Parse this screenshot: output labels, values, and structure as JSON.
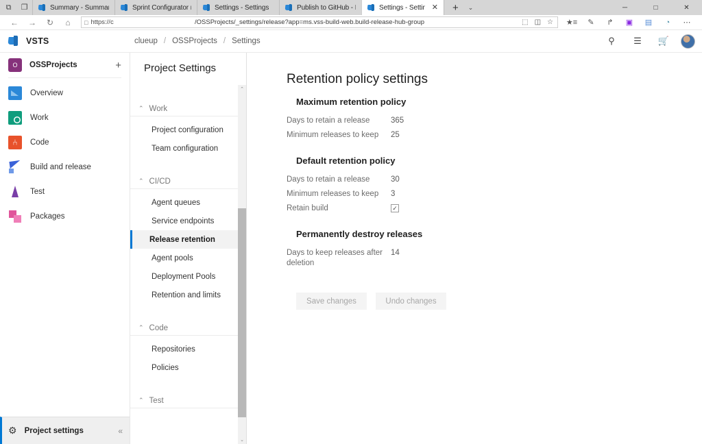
{
  "browser": {
    "window_controls": {
      "minimize": "─",
      "maximize": "□",
      "close": "✕"
    },
    "tab_controls": {
      "new_tab": "+",
      "tab_list": "⌄",
      "close_tab": "✕"
    },
    "left_buttons": [
      {
        "name": "tab-preview-icon",
        "glyph": "⧉"
      },
      {
        "name": "set-tabs-aside-icon",
        "glyph": "❐"
      }
    ],
    "tabs": [
      {
        "title": "Summary - Summary",
        "active": false
      },
      {
        "title": "Sprint Configurator master",
        "active": false
      },
      {
        "title": "Settings - Settings",
        "active": false
      },
      {
        "title": "Publish to GitHub - Build ar",
        "active": false
      },
      {
        "title": "Settings - Settings",
        "active": true
      }
    ],
    "nav_buttons": [
      {
        "name": "back-button",
        "glyph": "←"
      },
      {
        "name": "forward-button",
        "glyph": "→"
      },
      {
        "name": "refresh-button",
        "glyph": "↻"
      },
      {
        "name": "home-button",
        "glyph": "⌂"
      }
    ],
    "address": {
      "lock_glyph": "□",
      "prefix": "https://c",
      "path": "/OSSProjects/_settings/release?app=ms.vss-build-web.build-release-hub-group",
      "inline_icons": [
        {
          "name": "reading-view-icon",
          "glyph": "⬚"
        },
        {
          "name": "book-icon",
          "glyph": "◫"
        },
        {
          "name": "favorite-star-icon",
          "glyph": "☆"
        }
      ]
    },
    "toolbar_icons": [
      {
        "name": "favorites-hub-icon",
        "glyph": "★≡"
      },
      {
        "name": "web-notes-icon",
        "glyph": "✎"
      },
      {
        "name": "share-icon",
        "glyph": "↱"
      },
      {
        "name": "extension-icon",
        "glyph": "▣"
      },
      {
        "name": "devtools-icon",
        "glyph": "▤"
      },
      {
        "name": "cortana-icon",
        "glyph": "◔"
      },
      {
        "name": "more-menu-icon",
        "glyph": "⋯"
      }
    ]
  },
  "app_header": {
    "brand": "VSTS",
    "breadcrumb": [
      "clueup",
      "OSSProjects",
      "Settings"
    ],
    "breadcrumb_separator": "/",
    "actions": [
      {
        "name": "search-icon",
        "glyph": "⚲"
      },
      {
        "name": "work-items-icon",
        "glyph": "☰"
      },
      {
        "name": "marketplace-icon",
        "glyph": "Ὥ2"
      },
      {
        "name": "help-icon",
        "glyph": "?"
      }
    ]
  },
  "project_nav": {
    "project_initial": "O",
    "project_name": "OSSProjects",
    "add_glyph": "+",
    "items": [
      {
        "label": "Overview",
        "icon": "overview-icon"
      },
      {
        "label": "Work",
        "icon": "work-icon"
      },
      {
        "label": "Code",
        "icon": "code-icon"
      },
      {
        "label": "Build and release",
        "icon": "build-and-release-icon"
      },
      {
        "label": "Test",
        "icon": "test-icon"
      },
      {
        "label": "Packages",
        "icon": "packages-icon"
      }
    ],
    "footer": {
      "gear_glyph": "⚙",
      "label": "Project settings",
      "collapse_glyph": "«"
    }
  },
  "settings_nav": {
    "title": "Project Settings",
    "collapse_glyph": "⌃",
    "scroll_up_glyph": "⌃",
    "scroll_down_glyph": "⌄",
    "groups": [
      {
        "label": "Work",
        "items": [
          {
            "label": "Project configuration",
            "active": false
          },
          {
            "label": "Team configuration",
            "active": false
          }
        ]
      },
      {
        "label": "CI/CD",
        "items": [
          {
            "label": "Agent queues",
            "active": false
          },
          {
            "label": "Service endpoints",
            "active": false
          },
          {
            "label": "Release retention",
            "active": true
          },
          {
            "label": "Agent pools",
            "active": false
          },
          {
            "label": "Deployment Pools",
            "active": false
          },
          {
            "label": "Retention and limits",
            "active": false
          }
        ]
      },
      {
        "label": "Code",
        "items": [
          {
            "label": "Repositories",
            "active": false
          },
          {
            "label": "Policies",
            "active": false
          }
        ]
      },
      {
        "label": "Test",
        "items": []
      }
    ]
  },
  "content": {
    "page_title": "Retention policy settings",
    "sections": [
      {
        "heading": "Maximum retention policy",
        "fields": [
          {
            "label": "Days to retain a release",
            "value": "365",
            "type": "text"
          },
          {
            "label": "Minimum releases to keep",
            "value": "25",
            "type": "text"
          }
        ]
      },
      {
        "heading": "Default retention policy",
        "fields": [
          {
            "label": "Days to retain a release",
            "value": "30",
            "type": "text"
          },
          {
            "label": "Minimum releases to keep",
            "value": "3",
            "type": "text"
          },
          {
            "label": "Retain build",
            "value": "✓",
            "type": "checkbox",
            "checked": true
          }
        ]
      },
      {
        "heading": "Permanently destroy releases",
        "fields": [
          {
            "label": "Days to keep releases after deletion",
            "value": "14",
            "type": "text"
          }
        ]
      }
    ],
    "buttons": [
      {
        "label": "Save changes",
        "disabled": true
      },
      {
        "label": "Undo changes",
        "disabled": true
      }
    ]
  },
  "colors": {
    "accent": "#0078d4",
    "project_avatar": "#86327b",
    "chrome_tabstrip": "#d6d6d6",
    "active_nav_bg": "#f2f2f2"
  }
}
